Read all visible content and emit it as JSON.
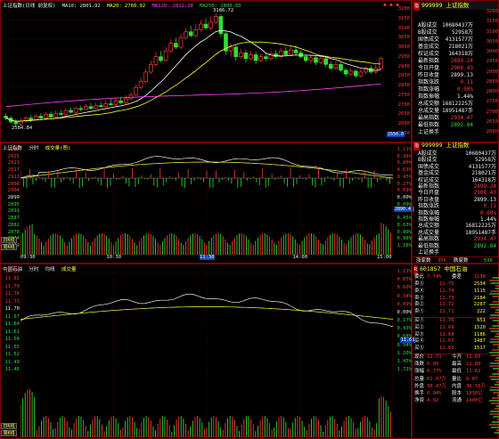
{
  "colors": {
    "up": "#ff3b3b",
    "down": "#33dd33",
    "bg": "#000000",
    "grid": "#7a0000",
    "ma10": "#ffffff",
    "ma20": "#ffff33",
    "ma120": "#ff44ff",
    "ma250": "#33dd33"
  },
  "kline": {
    "legend": {
      "title": "上证指数(日线 前复权)",
      "ma10": "MA10: 2801.92",
      "ma20": "MA20: 2760.92",
      "ma120": "MA120: 2812.24",
      "ma250": "MA250: 2800.83"
    },
    "axis": [
      "3200",
      "3150",
      "3100",
      "3050",
      "3000",
      "2950",
      "2900",
      "2850",
      "2800",
      "2750",
      "2700",
      "2650",
      "2600",
      "2550"
    ],
    "axis_last": "2550.0",
    "high_label": "3186.72",
    "low_label": "2584.84",
    "window_icon": "window-controls-icon",
    "candles": [
      [
        2650,
        2640,
        2665,
        2630
      ],
      [
        2640,
        2620,
        2650,
        2610
      ],
      [
        2620,
        2610,
        2635,
        2600
      ],
      [
        2610,
        2625,
        2640,
        2600
      ],
      [
        2625,
        2640,
        2650,
        2615
      ],
      [
        2640,
        2630,
        2655,
        2620
      ],
      [
        2630,
        2650,
        2660,
        2625
      ],
      [
        2650,
        2640,
        2665,
        2630
      ],
      [
        2640,
        2660,
        2670,
        2630
      ],
      [
        2660,
        2645,
        2675,
        2640
      ],
      [
        2645,
        2665,
        2680,
        2640
      ],
      [
        2665,
        2660,
        2680,
        2650
      ],
      [
        2660,
        2680,
        2690,
        2655
      ],
      [
        2680,
        2670,
        2695,
        2665
      ],
      [
        2670,
        2690,
        2700,
        2660
      ],
      [
        2690,
        2685,
        2705,
        2675
      ],
      [
        2685,
        2700,
        2715,
        2680
      ],
      [
        2700,
        2690,
        2720,
        2685
      ],
      [
        2690,
        2705,
        2720,
        2685
      ],
      [
        2705,
        2700,
        2725,
        2695
      ],
      [
        2700,
        2715,
        2735,
        2695
      ],
      [
        2715,
        2710,
        2740,
        2705
      ],
      [
        2710,
        2730,
        2745,
        2700
      ],
      [
        2730,
        2720,
        2750,
        2715
      ],
      [
        2720,
        2740,
        2760,
        2715
      ],
      [
        2740,
        2760,
        2775,
        2735
      ],
      [
        2760,
        2800,
        2815,
        2755
      ],
      [
        2800,
        2830,
        2850,
        2790
      ],
      [
        2830,
        2880,
        2895,
        2820
      ],
      [
        2880,
        2920,
        2940,
        2870
      ],
      [
        2920,
        2960,
        2985,
        2910
      ],
      [
        2960,
        2940,
        2990,
        2930
      ],
      [
        2940,
        2990,
        3010,
        2935
      ],
      [
        2990,
        3030,
        3050,
        2980
      ],
      [
        3030,
        3010,
        3060,
        3000
      ],
      [
        3010,
        3060,
        3080,
        3000
      ],
      [
        3060,
        3090,
        3110,
        3050
      ],
      [
        3090,
        3070,
        3120,
        3060
      ],
      [
        3070,
        3100,
        3130,
        3060
      ],
      [
        3100,
        3130,
        3150,
        3090
      ],
      [
        3130,
        3110,
        3160,
        3100
      ],
      [
        3110,
        3140,
        3170,
        3100
      ],
      [
        3140,
        3170,
        3186,
        3130
      ],
      [
        3170,
        3080,
        3180,
        3060
      ],
      [
        3080,
        2990,
        3090,
        2970
      ],
      [
        2990,
        3010,
        3030,
        2960
      ],
      [
        3010,
        2960,
        3020,
        2940
      ],
      [
        2960,
        2980,
        3000,
        2950
      ],
      [
        2980,
        2950,
        2995,
        2930
      ],
      [
        2950,
        2970,
        2990,
        2940
      ],
      [
        2970,
        2940,
        2985,
        2920
      ],
      [
        2940,
        2960,
        2975,
        2930
      ],
      [
        2960,
        2950,
        2980,
        2935
      ],
      [
        2950,
        2975,
        2990,
        2940
      ],
      [
        2975,
        2960,
        2995,
        2950
      ],
      [
        2960,
        2990,
        3005,
        2955
      ],
      [
        2990,
        2970,
        3010,
        2960
      ],
      [
        2970,
        2995,
        3015,
        2965
      ],
      [
        2995,
        2980,
        3020,
        2970
      ],
      [
        2980,
        2960,
        2995,
        2950
      ],
      [
        2960,
        2940,
        2975,
        2930
      ],
      [
        2940,
        2955,
        2970,
        2925
      ],
      [
        2955,
        2930,
        2965,
        2915
      ],
      [
        2930,
        2950,
        2960,
        2920
      ],
      [
        2950,
        2920,
        2960,
        2905
      ],
      [
        2920,
        2900,
        2935,
        2890
      ],
      [
        2900,
        2920,
        2935,
        2890
      ],
      [
        2920,
        2890,
        2930,
        2880
      ],
      [
        2890,
        2870,
        2900,
        2855
      ],
      [
        2870,
        2885,
        2900,
        2860
      ],
      [
        2885,
        2860,
        2895,
        2850
      ],
      [
        2860,
        2880,
        2895,
        2850
      ],
      [
        2880,
        2900,
        2910,
        2870
      ],
      [
        2900,
        2880,
        2915,
        2870
      ],
      [
        2880,
        2899,
        2920,
        2870
      ],
      [
        2899,
        2950,
        2960,
        2890
      ]
    ]
  },
  "intraday": {
    "legend": {
      "title": "上证指数",
      "label2": "分时",
      "label3": "成交量(图)"
    },
    "axis_left": [
      "2930",
      "2925",
      "2921",
      "2917",
      "2913",
      "2908",
      "2904",
      "2899",
      "2895",
      "2891",
      "2887",
      "2882",
      "2878",
      "2874",
      "2869"
    ],
    "axis_right": [
      "1.11%",
      "0.98%",
      "0.80%",
      "0.63%",
      "0.45%",
      "0.27%",
      "0.09%",
      "0.00%",
      "0.09%",
      "0.27%",
      "0.45%",
      "0.63%",
      "0.80%",
      "0.98%",
      "1.16%"
    ],
    "vol_axis": [
      "20",
      "16",
      "12",
      "8",
      "4"
    ],
    "time_labels": [
      "09:30",
      "10:30",
      "11:30",
      "14:00",
      "15:00"
    ],
    "price_now": "2890.41",
    "buttons": [
      "日K线",
      "周K线"
    ]
  },
  "stock": {
    "legend": {
      "title": "中国石油",
      "label2": "分时",
      "label3": "均线",
      "label4": "成交量"
    },
    "axis_left": [
      "11.85",
      "11.82",
      "11.79",
      "11.76",
      "11.73",
      "11.70",
      "11.67",
      "11.64",
      "11.61",
      "11.58",
      "11.55",
      "11.52",
      "11.49",
      "11.46"
    ],
    "axis_right": [
      "1.11%",
      "0.85%",
      "0.60%",
      "0.34%",
      "0.09%",
      "0.00%",
      "0.17%",
      "0.43%",
      "0.68%",
      "0.94%",
      "1.20%",
      "1.45%",
      "1.71%"
    ],
    "vol_axis": [
      "30",
      "20",
      "10"
    ],
    "price_now": "11.66",
    "buttons": [
      "日K线",
      "周K线"
    ]
  },
  "index_panel": {
    "code": "999999",
    "name": "上证指数",
    "rows": [
      {
        "k": "A股成交",
        "v": "10680437万",
        "c": "white"
      },
      {
        "k": "B股成交",
        "v": "52958万",
        "c": "white"
      },
      {
        "k": "国债成交",
        "v": "4131577万",
        "c": "white"
      },
      {
        "k": "基金成交",
        "v": "218021万",
        "c": "white"
      },
      {
        "k": "权证成交",
        "v": "164318万",
        "c": "white"
      },
      {
        "k": "最新指数",
        "v": "2899.24",
        "c": "red"
      },
      {
        "k": "今日开盘",
        "v": "2908.43",
        "c": "red"
      },
      {
        "k": "昨日收盘",
        "v": "2899.13",
        "c": "white"
      },
      {
        "k": "指数涨跌",
        "v": "0.11",
        "c": "red"
      },
      {
        "k": "指数涨幅",
        "v": "0.00%",
        "c": "red"
      },
      {
        "k": "指数振幅",
        "v": "1.44%",
        "c": "white"
      },
      {
        "k": "总成交额",
        "v": "16812225万",
        "c": "white"
      },
      {
        "k": "总成交量",
        "v": "18951487手",
        "c": "white"
      },
      {
        "k": "最高指数",
        "v": "2934.47",
        "c": "red"
      },
      {
        "k": "最低指数",
        "v": "2892.84",
        "c": "green"
      },
      {
        "k": "上证换手",
        "v": "",
        "c": "white"
      }
    ],
    "axis_right": [
      "3200",
      "3150",
      "3100",
      "3050",
      "3000",
      "2950",
      "2900",
      "2850",
      "2800",
      "2750",
      "2700",
      "2650",
      "2600"
    ]
  },
  "index_panel2": {
    "code": "999999",
    "name": "上证指数",
    "rows": [
      {
        "k": "A股成交",
        "v": "10680437万",
        "c": "white"
      },
      {
        "k": "B股成交",
        "v": "52958万",
        "c": "white"
      },
      {
        "k": "国债成交",
        "v": "4131577万",
        "c": "white"
      },
      {
        "k": "基金成交",
        "v": "218021万",
        "c": "white"
      },
      {
        "k": "权证成交",
        "v": "164318万",
        "c": "white"
      },
      {
        "k": "最新指数",
        "v": "2899.24",
        "c": "red"
      },
      {
        "k": "今日开盘",
        "v": "2908.43",
        "c": "red"
      },
      {
        "k": "昨日收盘",
        "v": "2899.13",
        "c": "white"
      },
      {
        "k": "指数涨跌",
        "v": "0.11",
        "c": "red"
      },
      {
        "k": "指数涨幅",
        "v": "0.00%",
        "c": "red"
      },
      {
        "k": "指数振幅",
        "v": "1.44%",
        "c": "white"
      },
      {
        "k": "总成交额",
        "v": "16812225万",
        "c": "white"
      },
      {
        "k": "总成交量",
        "v": "18951487手",
        "c": "white"
      },
      {
        "k": "最高指数",
        "v": "2934.47",
        "c": "red"
      },
      {
        "k": "最低指数",
        "v": "2892.84",
        "c": "green"
      },
      {
        "k": "上证换手",
        "v": "",
        "c": "white"
      }
    ],
    "updown": {
      "up_label": "涨家数",
      "up": "356",
      "down_label": "跌家数",
      "down": "536"
    }
  },
  "stock_panel": {
    "code": "601857",
    "name": "中国石油",
    "weibi_label": "委比",
    "weibi": "7.74%",
    "weicha_label": "委差",
    "weicha": "1138",
    "sell": [
      {
        "k": "卖⑤",
        "p": "11.75",
        "q": "2534"
      },
      {
        "k": "卖④",
        "p": "11.74",
        "q": "1115"
      },
      {
        "k": "卖③",
        "p": "11.73",
        "q": "2184"
      },
      {
        "k": "卖②",
        "p": "11.72",
        "q": "2287"
      },
      {
        "k": "卖①",
        "p": "11.71",
        "q": "222"
      }
    ],
    "buy": [
      {
        "k": "买①",
        "p": "11.70",
        "q": "651"
      },
      {
        "k": "买②",
        "p": "11.69",
        "q": "1520"
      },
      {
        "k": "买③",
        "p": "11.68",
        "q": "1186"
      },
      {
        "k": "买④",
        "p": "11.67",
        "q": "1487"
      },
      {
        "k": "买⑤",
        "p": "11.66",
        "q": "1517"
      }
    ],
    "stats": [
      {
        "k1": "现价",
        "v1": "11.71",
        "k2": "今开",
        "v2": "11.65"
      },
      {
        "k1": "涨跌",
        "v1": "0.09",
        "k2": "最高",
        "v2": "11.80"
      },
      {
        "k1": "涨幅",
        "v1": "0.77%",
        "k2": "最低",
        "v2": "11.62"
      },
      {
        "k1": "总量",
        "v1": "61.07万",
        "k2": "量比",
        "v2": "0.87"
      },
      {
        "k1": "外盘",
        "v1": "30.47万",
        "k2": "内盘",
        "v2": "30.56万"
      },
      {
        "k1": "换手",
        "v1": "0.04%",
        "k2": "股本",
        "v2": "1830亿"
      },
      {
        "k1": "净资",
        "v1": "4.92",
        "k2": "流通",
        "v2": "1400亿"
      }
    ]
  }
}
